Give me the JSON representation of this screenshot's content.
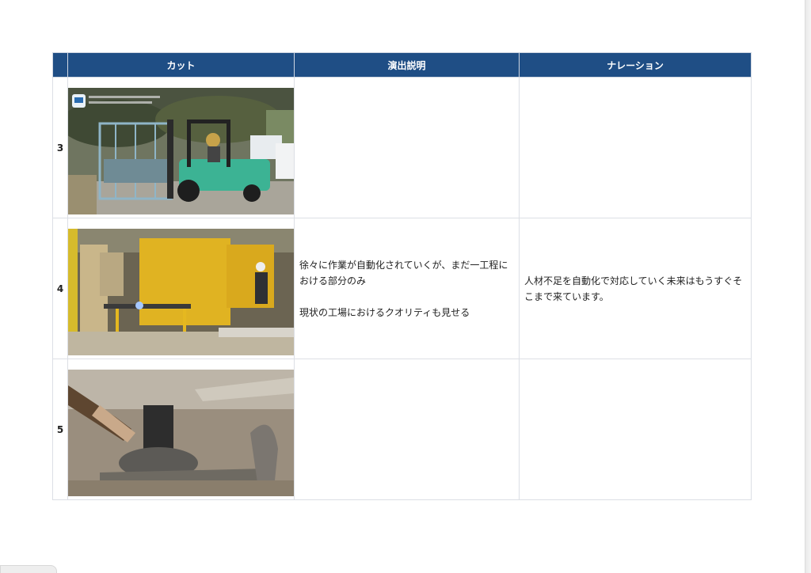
{
  "table": {
    "headers": {
      "cut": "カット",
      "description": "演出説明",
      "narration": "ナレーション"
    },
    "rows": [
      {
        "number": "3",
        "image": "forklift-carrying-steel-frame-photo",
        "description": [],
        "narration": []
      },
      {
        "number": "4",
        "image": "robot-welding-cell-photo",
        "description": [
          "徐々に作業が自動化されていくが、まだ一工程に",
          "おける部分のみ",
          "",
          "現状の工場におけるクオリティも見せる"
        ],
        "narration": [
          "人材不足を自動化で対応していく未来はもうすぐそ",
          "こまで来ています。"
        ]
      },
      {
        "number": "5",
        "image": "welding-torch-closeup-photo",
        "description": [],
        "narration": []
      }
    ]
  },
  "colors": {
    "header_bg": "#1f4e85",
    "header_text": "#ffffff",
    "row_number": "#1f4e85",
    "border": "#dcdfe5"
  }
}
